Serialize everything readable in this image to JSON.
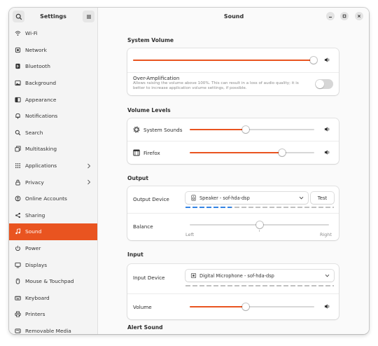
{
  "sidebar": {
    "title": "Settings",
    "items": [
      {
        "label": "Wi-Fi",
        "icon": "wifi-icon"
      },
      {
        "label": "Network",
        "icon": "network-icon"
      },
      {
        "label": "Bluetooth",
        "icon": "bluetooth-icon"
      },
      {
        "label": "Background",
        "icon": "background-icon"
      },
      {
        "label": "Appearance",
        "icon": "appearance-icon"
      },
      {
        "label": "Notifications",
        "icon": "notifications-icon"
      },
      {
        "label": "Search",
        "icon": "search-icon"
      },
      {
        "label": "Multitasking",
        "icon": "multitasking-icon"
      },
      {
        "label": "Applications",
        "icon": "applications-icon"
      },
      {
        "label": "Privacy",
        "icon": "privacy-icon"
      },
      {
        "label": "Online Accounts",
        "icon": "online-accounts-icon"
      },
      {
        "label": "Sharing",
        "icon": "sharing-icon"
      },
      {
        "label": "Sound",
        "icon": "sound-icon"
      },
      {
        "label": "Power",
        "icon": "power-icon"
      },
      {
        "label": "Displays",
        "icon": "displays-icon"
      },
      {
        "label": "Mouse & Touchpad",
        "icon": "mouse-icon"
      },
      {
        "label": "Keyboard",
        "icon": "keyboard-icon"
      },
      {
        "label": "Printers",
        "icon": "printers-icon"
      },
      {
        "label": "Removable Media",
        "icon": "removable-media-icon"
      }
    ]
  },
  "main": {
    "title": "Sound",
    "system_volume": {
      "heading": "System Volume",
      "level": 1.0,
      "over_amplification_label": "Over-Amplification",
      "over_amplification_desc_1": "Allows raising the volume above 100%. This can result in a loss of audio quality; it is",
      "over_amplification_desc_2": "better to increase application volume settings, if possible.",
      "over_amplification_on": false
    },
    "volume_levels": {
      "heading": "Volume Levels",
      "system_sounds_label": "System Sounds",
      "system_sounds_level": 0.45,
      "firefox_label": "Firefox",
      "firefox_level": 0.74
    },
    "output": {
      "heading": "Output",
      "device_label": "Output Device",
      "device_value": "Speaker - sof-hda-dsp",
      "test_label": "Test",
      "balance_label": "Balance",
      "balance_left": "Left",
      "balance_right": "Right",
      "balance_level": 0.5
    },
    "input": {
      "heading": "Input",
      "device_label": "Input Device",
      "device_value": "Digital Microphone - sof-hda-dsp",
      "volume_label": "Volume",
      "volume_level": 0.45
    },
    "alert_sound": {
      "heading": "Alert Sound"
    }
  },
  "colors": {
    "accent": "#e95420",
    "active_sidebar_text": "#ffffff",
    "level_meter_active": "#3584e4",
    "level_meter_idle": "#c0c0c0"
  }
}
